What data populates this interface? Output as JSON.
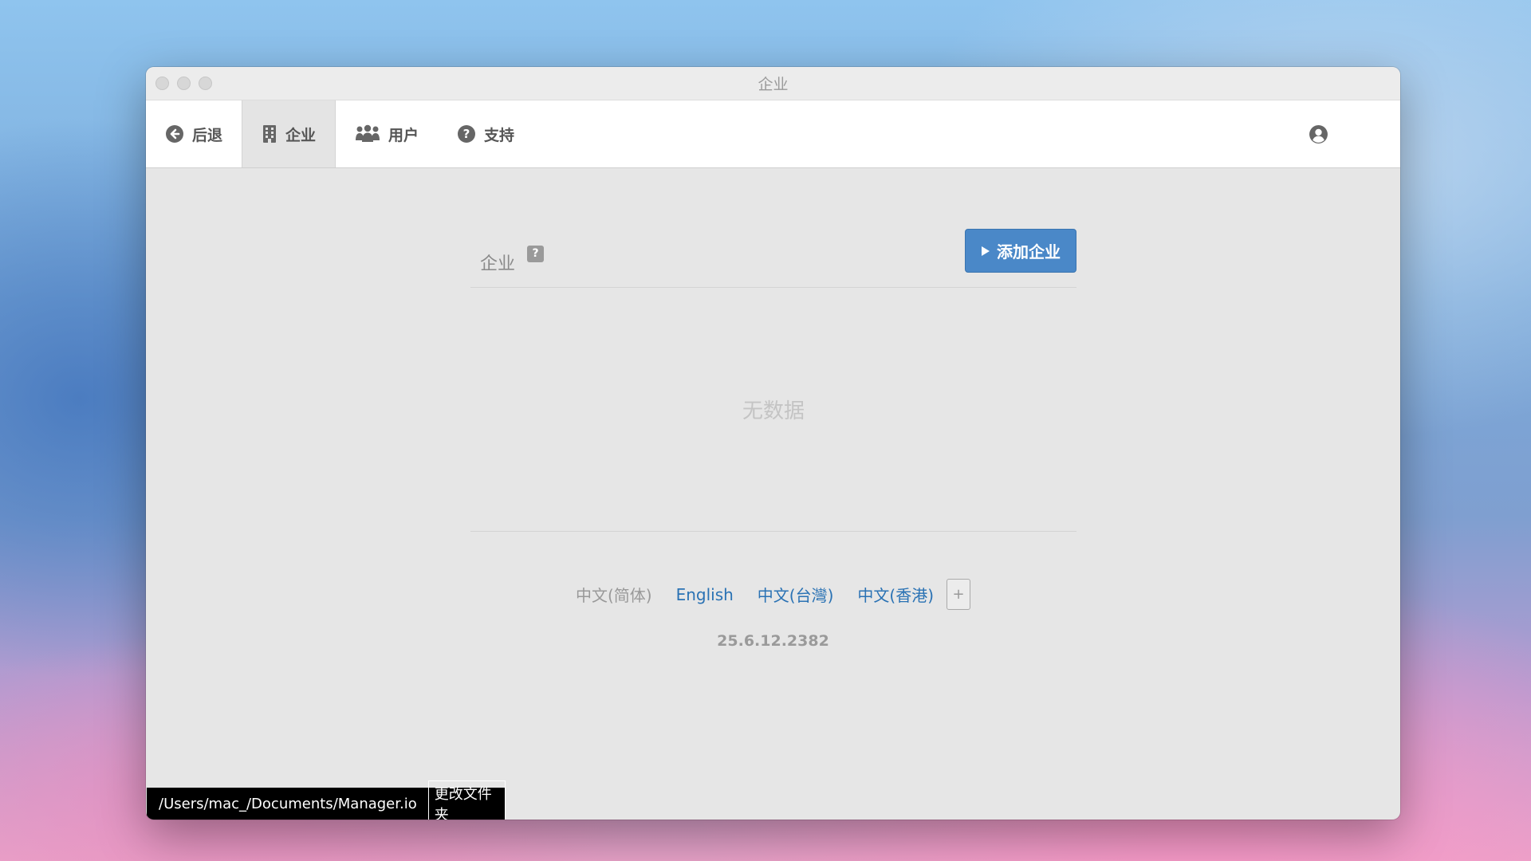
{
  "window": {
    "title": "企业"
  },
  "nav": {
    "back": "后退",
    "businesses": "企业",
    "users": "用户",
    "support": "支持"
  },
  "panel": {
    "title": "企业",
    "help": "?",
    "add_button": "添加企业",
    "empty": "无数据"
  },
  "languages": {
    "current": "中文(简体)",
    "links": [
      "English",
      "中文(台灣)",
      "中文(香港)"
    ],
    "add": "+"
  },
  "version": "25.6.12.2382",
  "footer": {
    "path": "/Users/mac_/Documents/Manager.io",
    "change_folder": "更改文件夹"
  },
  "colors": {
    "accent": "#4a88c8",
    "link": "#2a72b4"
  }
}
